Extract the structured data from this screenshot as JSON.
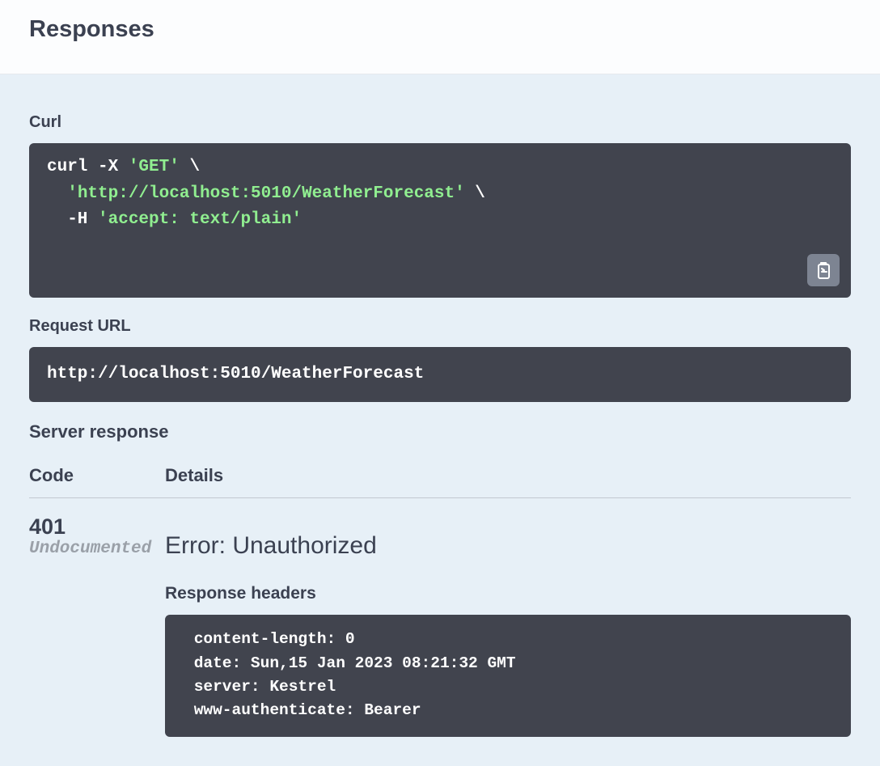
{
  "title": "Responses",
  "curl": {
    "label": "Curl",
    "cmd_prefix": "curl -X ",
    "method_q": "'GET'",
    "slash1": " \\",
    "indent1": "  ",
    "url_q": "'http://localhost:5010/WeatherForecast'",
    "slash2": " \\",
    "indent2": "  -H ",
    "header_q": "'accept: text/plain'"
  },
  "request_url": {
    "label": "Request URL",
    "value": "http://localhost:5010/WeatherForecast"
  },
  "server_response": {
    "label": "Server response",
    "col_code": "Code",
    "col_details": "Details",
    "code": "401",
    "undocumented": "Undocumented",
    "error": "Error: Unauthorized",
    "headers_label": "Response headers",
    "headers": [
      " content-length: 0 ",
      " date: Sun,15 Jan 2023 08:21:32 GMT ",
      " server: Kestrel ",
      " www-authenticate: Bearer "
    ]
  }
}
